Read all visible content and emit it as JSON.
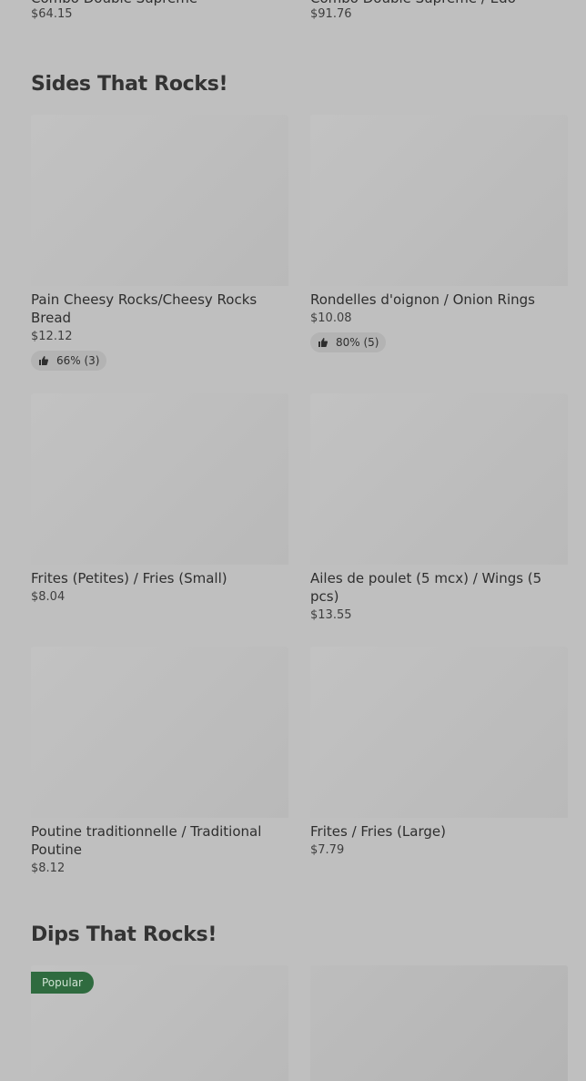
{
  "top_row": [
    {
      "name": "Combo Double Supreme",
      "price": "$64.15"
    },
    {
      "name": "Combo Double Supreme / Edo",
      "price": "$91.76"
    }
  ],
  "sections": [
    {
      "title": "Sides That Rocks!",
      "items": [
        {
          "name": "Pain Cheesy Rocks/Cheesy Rocks Bread",
          "price": "$12.12",
          "rating": "66% (3)"
        },
        {
          "name": "Rondelles d'oignon / Onion Rings",
          "price": "$10.08",
          "rating": "80% (5)"
        },
        {
          "name": "Frites (Petites) / Fries (Small)",
          "price": "$8.04"
        },
        {
          "name": "Ailes de poulet (5 mcx) / Wings (5 pcs)",
          "price": "$13.55"
        },
        {
          "name": "Poutine traditionnelle / Traditional Poutine",
          "price": "$8.12"
        },
        {
          "name": "Frites / Fries (Large)",
          "price": "$7.79"
        }
      ]
    },
    {
      "title": "Dips That Rocks!",
      "items": [
        {
          "badge": "Popular"
        },
        {}
      ]
    }
  ],
  "icons": {
    "rating_icon": "thumbs-up-icon"
  },
  "colors": {
    "background": "#bfbfbf",
    "image_placeholder": "#bababa",
    "badge": "#2f6b3f"
  }
}
